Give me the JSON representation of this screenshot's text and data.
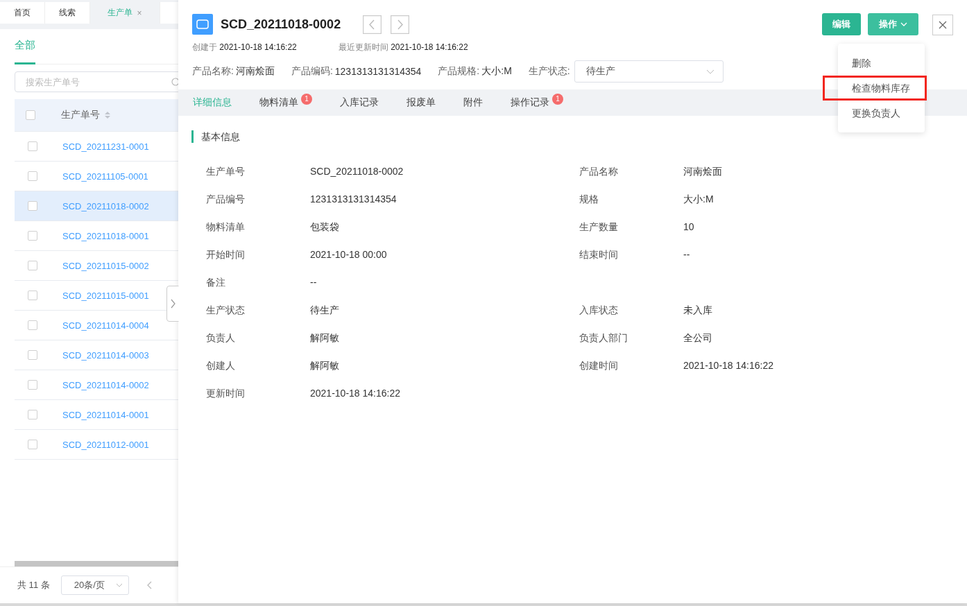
{
  "nav_tabs": [
    {
      "label": "首页",
      "selected": false
    },
    {
      "label": "线索",
      "selected": false
    },
    {
      "label": "生产单",
      "selected": true,
      "close": "×"
    }
  ],
  "list": {
    "filter_tabs": [
      {
        "label": "全部",
        "selected": true
      }
    ],
    "search": {
      "placeholder": "搜索生产单号"
    },
    "column": "生产单号",
    "header_checked": false,
    "rows": [
      {
        "number": "SCD_20211231-0001",
        "selected": false,
        "checked": false
      },
      {
        "number": "SCD_20211105-0001",
        "selected": false,
        "checked": false
      },
      {
        "number": "SCD_20211018-0002",
        "selected": true,
        "checked": false
      },
      {
        "number": "SCD_20211018-0001",
        "selected": false,
        "checked": false
      },
      {
        "number": "SCD_20211015-0002",
        "selected": false,
        "checked": false
      },
      {
        "number": "SCD_20211015-0001",
        "selected": false,
        "checked": false
      },
      {
        "number": "SCD_20211014-0004",
        "selected": false,
        "checked": false
      },
      {
        "number": "SCD_20211014-0003",
        "selected": false,
        "checked": false
      },
      {
        "number": "SCD_20211014-0002",
        "selected": false,
        "checked": false
      },
      {
        "number": "SCD_20211014-0001",
        "selected": false,
        "checked": false
      },
      {
        "number": "SCD_20211012-0001",
        "selected": false,
        "checked": false
      }
    ],
    "total": "共 11 条",
    "page_size": "20条/页"
  },
  "drawer": {
    "title": "SCD_20211018-0002",
    "created_label": "创建于",
    "created": "2021-10-18 14:16:22",
    "updated_label": "最近更新时间",
    "updated": "2021-10-18 14:16:22",
    "summary": [
      {
        "label": "产品名称:",
        "value": "河南烩面"
      },
      {
        "label": "产品编码:",
        "value": "1231313131314354"
      },
      {
        "label": "产品规格:",
        "value": "大小:M"
      }
    ],
    "status_label": "生产状态:",
    "status": "待生产",
    "buttons": [
      {
        "label": "编辑",
        "kind": "primary"
      },
      {
        "label": "操作",
        "kind": "menu"
      }
    ],
    "menu": [
      {
        "label": "删除",
        "highlighted": false
      },
      {
        "label": "检查物料库存",
        "highlighted": true
      },
      {
        "label": "更换负责人",
        "highlighted": false
      }
    ],
    "tabs": [
      {
        "label": "详细信息",
        "selected": true
      },
      {
        "label": "物料清单",
        "selected": false,
        "badge": "1"
      },
      {
        "label": "入库记录",
        "selected": false
      },
      {
        "label": "报废单",
        "selected": false
      },
      {
        "label": "附件",
        "selected": false
      },
      {
        "label": "操作记录",
        "selected": false,
        "badge": "1"
      }
    ],
    "section": "基本信息",
    "fields": [
      [
        {
          "label": "生产单号",
          "value": "SCD_20211018-0002"
        },
        {
          "label": "产品名称",
          "value": "河南烩面"
        }
      ],
      [
        {
          "label": "产品编号",
          "value": "1231313131314354"
        },
        {
          "label": "规格",
          "value": "大小:M"
        }
      ],
      [
        {
          "label": "物料清单",
          "value": "包装袋"
        },
        {
          "label": "生产数量",
          "value": "10"
        }
      ],
      [
        {
          "label": "开始时间",
          "value": "2021-10-18 00:00"
        },
        {
          "label": "结束时间",
          "value": "--"
        }
      ],
      [
        {
          "label": "备注",
          "value": "--"
        }
      ],
      [
        {
          "label": "生产状态",
          "value": "待生产"
        },
        {
          "label": "入库状态",
          "value": "未入库"
        }
      ],
      [
        {
          "label": "负责人",
          "value": "解阿敏"
        },
        {
          "label": "负责人部门",
          "value": "全公司"
        }
      ],
      [
        {
          "label": "创建人",
          "value": "解阿敏"
        },
        {
          "label": "创建时间",
          "value": "2021-10-18 14:16:22"
        }
      ],
      [
        {
          "label": "更新时间",
          "value": "2021-10-18 14:16:22"
        }
      ]
    ]
  }
}
